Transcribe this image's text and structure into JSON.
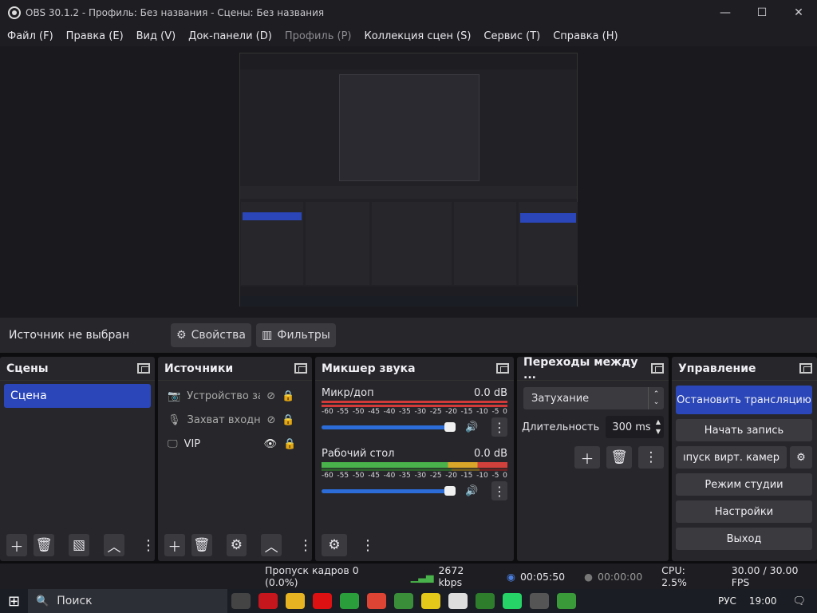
{
  "window": {
    "title": "OBS 30.1.2 - Профиль: Без названия - Сцены: Без названия",
    "minimize": "—",
    "maximize": "☐",
    "close": "✕"
  },
  "menu": [
    {
      "label": "Файл (F)"
    },
    {
      "label": "Правка (E)"
    },
    {
      "label": "Вид (V)"
    },
    {
      "label": "Док-панели (D)"
    },
    {
      "label": "Профиль (P)",
      "disabled": true
    },
    {
      "label": "Коллекция сцен (S)"
    },
    {
      "label": "Сервис (T)"
    },
    {
      "label": "Справка (H)"
    }
  ],
  "source_bar": {
    "no_source": "Источник не выбран",
    "properties": "Свойства",
    "filters": "Фильтры"
  },
  "scenes": {
    "title": "Сцены",
    "items": [
      "Сцена"
    ]
  },
  "sources": {
    "title": "Источники",
    "items": [
      {
        "name": "Устройство захвата видео",
        "icon": "camera-icon",
        "visible": false
      },
      {
        "name": "Захват входного аудиопотока",
        "icon": "microphone-icon",
        "visible": false
      },
      {
        "name": "VIP",
        "icon": "display-icon",
        "visible": true
      }
    ]
  },
  "mixer": {
    "title": "Микшер звука",
    "channels": [
      {
        "name": "Микр/доп",
        "db": "0.0 dB",
        "level": 0.0
      },
      {
        "name": "Рабочий стол",
        "db": "0.0 dB",
        "level": 0.7
      }
    ],
    "ticks": [
      "-60",
      "-55",
      "-50",
      "-45",
      "-40",
      "-35",
      "-30",
      "-25",
      "-20",
      "-15",
      "-10",
      "-5",
      "0"
    ]
  },
  "transitions": {
    "title": "Переходы между ...",
    "selected": "Затухание",
    "duration_label": "Длительность",
    "duration": "300 ms"
  },
  "controls": {
    "title": "Управление",
    "stop_stream": "Остановить трансляцию",
    "start_record": "Начать запись",
    "virtual_cam": "ıпуск вирт. камер",
    "studio_mode": "Режим студии",
    "settings": "Настройки",
    "exit": "Выход"
  },
  "status": {
    "dropped": "Пропуск кадров 0 (0.0%)",
    "bitrate": "2672 kbps",
    "stream_time": "00:05:50",
    "record_time": "00:00:00",
    "cpu": "CPU: 2.5%",
    "fps": "30.00 / 30.00 FPS"
  },
  "taskbar": {
    "search": "Поиск",
    "lang": "РУС",
    "time": "19:00"
  },
  "colors": {
    "accent": "#2a46b8",
    "bg": "#27272b",
    "meter_green": "#49b24a",
    "meter_yellow": "#d9a62a",
    "meter_red": "#d2403c"
  }
}
